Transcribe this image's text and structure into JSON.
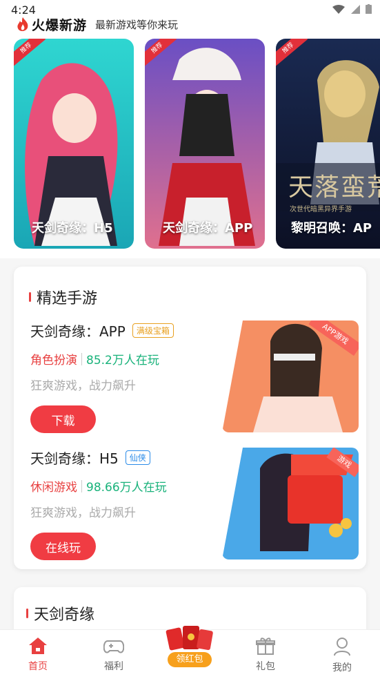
{
  "status_bar": {
    "time": "4:24"
  },
  "header": {
    "app_name": "火爆新游",
    "slogan": "最新游戏等你来玩"
  },
  "carousel": [
    {
      "title": "天剑奇缘：H5",
      "ribbon": "推荐"
    },
    {
      "title": "天剑奇缘：APP",
      "ribbon": "推荐"
    },
    {
      "title": "黎明召唤：AP",
      "ribbon": "推荐",
      "art_text": "天落蛮荒",
      "art_subtext": "次世代暗黑异界手游"
    }
  ],
  "featured": {
    "title": "精选手游",
    "games": [
      {
        "name": "天剑奇缘：APP",
        "tag": "满级宝箱",
        "tag_color": "#e8a020",
        "genre": "角色扮演",
        "players": "85.2万人在玩",
        "desc": "狂爽游戏，战力飙升",
        "button": "下载",
        "corner_badge": "APP游戏"
      },
      {
        "name": "天剑奇缘：H5",
        "tag": "仙侠",
        "tag_color": "#2a8be8",
        "genre": "休闲游戏",
        "players": "98.66万人在玩",
        "desc": "狂爽游戏，战力飙升",
        "button": "在线玩",
        "corner_badge": "游戏"
      }
    ]
  },
  "section2": {
    "title": "天剑奇缘"
  },
  "bottom_nav": {
    "items": [
      {
        "label": "首页",
        "icon": "home-icon",
        "active": true
      },
      {
        "label": "福利",
        "icon": "gamepad-icon",
        "active": false
      },
      {
        "label": "领红包",
        "icon": "red-envelope-icon",
        "active": false
      },
      {
        "label": "礼包",
        "icon": "gift-icon",
        "active": false
      },
      {
        "label": "我的",
        "icon": "user-icon",
        "active": false
      }
    ]
  },
  "colors": {
    "accent": "#e84040",
    "green": "#18b27a",
    "button": "#f03c43"
  }
}
